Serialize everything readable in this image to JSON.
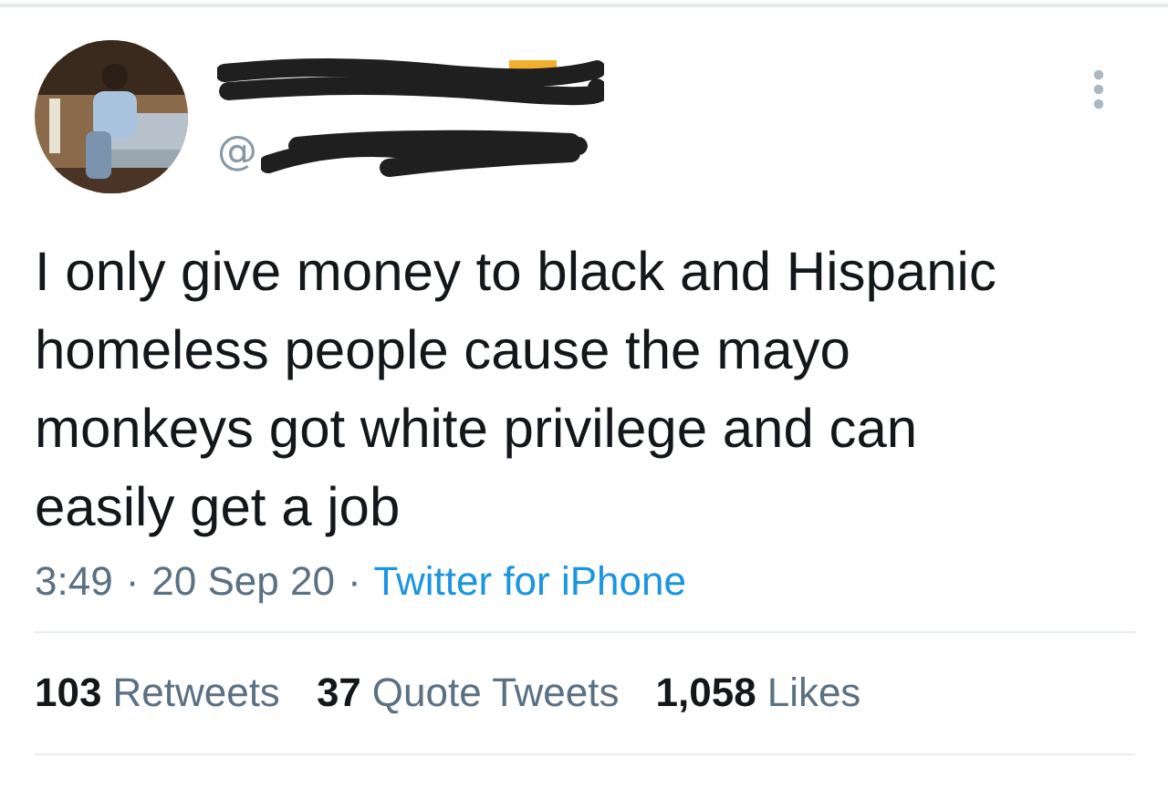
{
  "tweet": {
    "author": {
      "name_redacted": true,
      "handle_prefix": "@",
      "handle_redacted": true
    },
    "text": "I only give money to black and Hispanic homeless people cause the mayo monkeys got white privilege and can easily get a job",
    "meta": [
      {
        "text": "3:49",
        "kind": "plain"
      },
      {
        "text": "·",
        "kind": "plain"
      },
      {
        "text": "20 Sep 20",
        "kind": "plain"
      },
      {
        "text": "·",
        "kind": "plain"
      },
      {
        "text": "Twitter for iPhone",
        "kind": "link"
      }
    ],
    "stats": [
      {
        "count": "103",
        "label": "Retweets"
      },
      {
        "count": "37",
        "label": "Quote Tweets"
      },
      {
        "count": "1,058",
        "label": "Likes"
      }
    ]
  }
}
